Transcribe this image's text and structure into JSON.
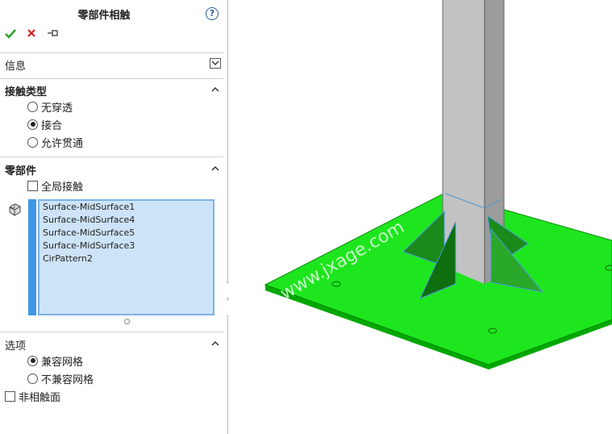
{
  "panel": {
    "title": "零部件相触",
    "help_icon": "?",
    "toolbar": {
      "ok_icon": "checkmark-icon",
      "cancel_icon": "close-icon",
      "pin_icon": "pin-icon"
    },
    "info": {
      "label": "信息"
    },
    "contact_type": {
      "label": "接触类型",
      "options": [
        {
          "label": "无穿透",
          "selected": false
        },
        {
          "label": "接合",
          "selected": true
        },
        {
          "label": "允许贯通",
          "selected": false
        }
      ]
    },
    "components": {
      "label": "零部件",
      "global_contact_label": "全局接触",
      "global_contact_checked": false,
      "items": [
        "Surface-MidSurface1",
        "Surface-MidSurface4",
        "Surface-MidSurface5",
        "Surface-MidSurface3",
        "CirPattern2"
      ]
    },
    "options": {
      "label": "选项",
      "mesh_options": [
        {
          "label": "兼容网格",
          "selected": true
        },
        {
          "label": "不兼容网格",
          "selected": false
        }
      ],
      "non_touching_label": "非相触面",
      "non_touching_checked": false
    }
  },
  "viewport": {
    "watermark": "www.jxage.com",
    "plate_color": "#00e600",
    "column_color": "#b8b8b8"
  }
}
